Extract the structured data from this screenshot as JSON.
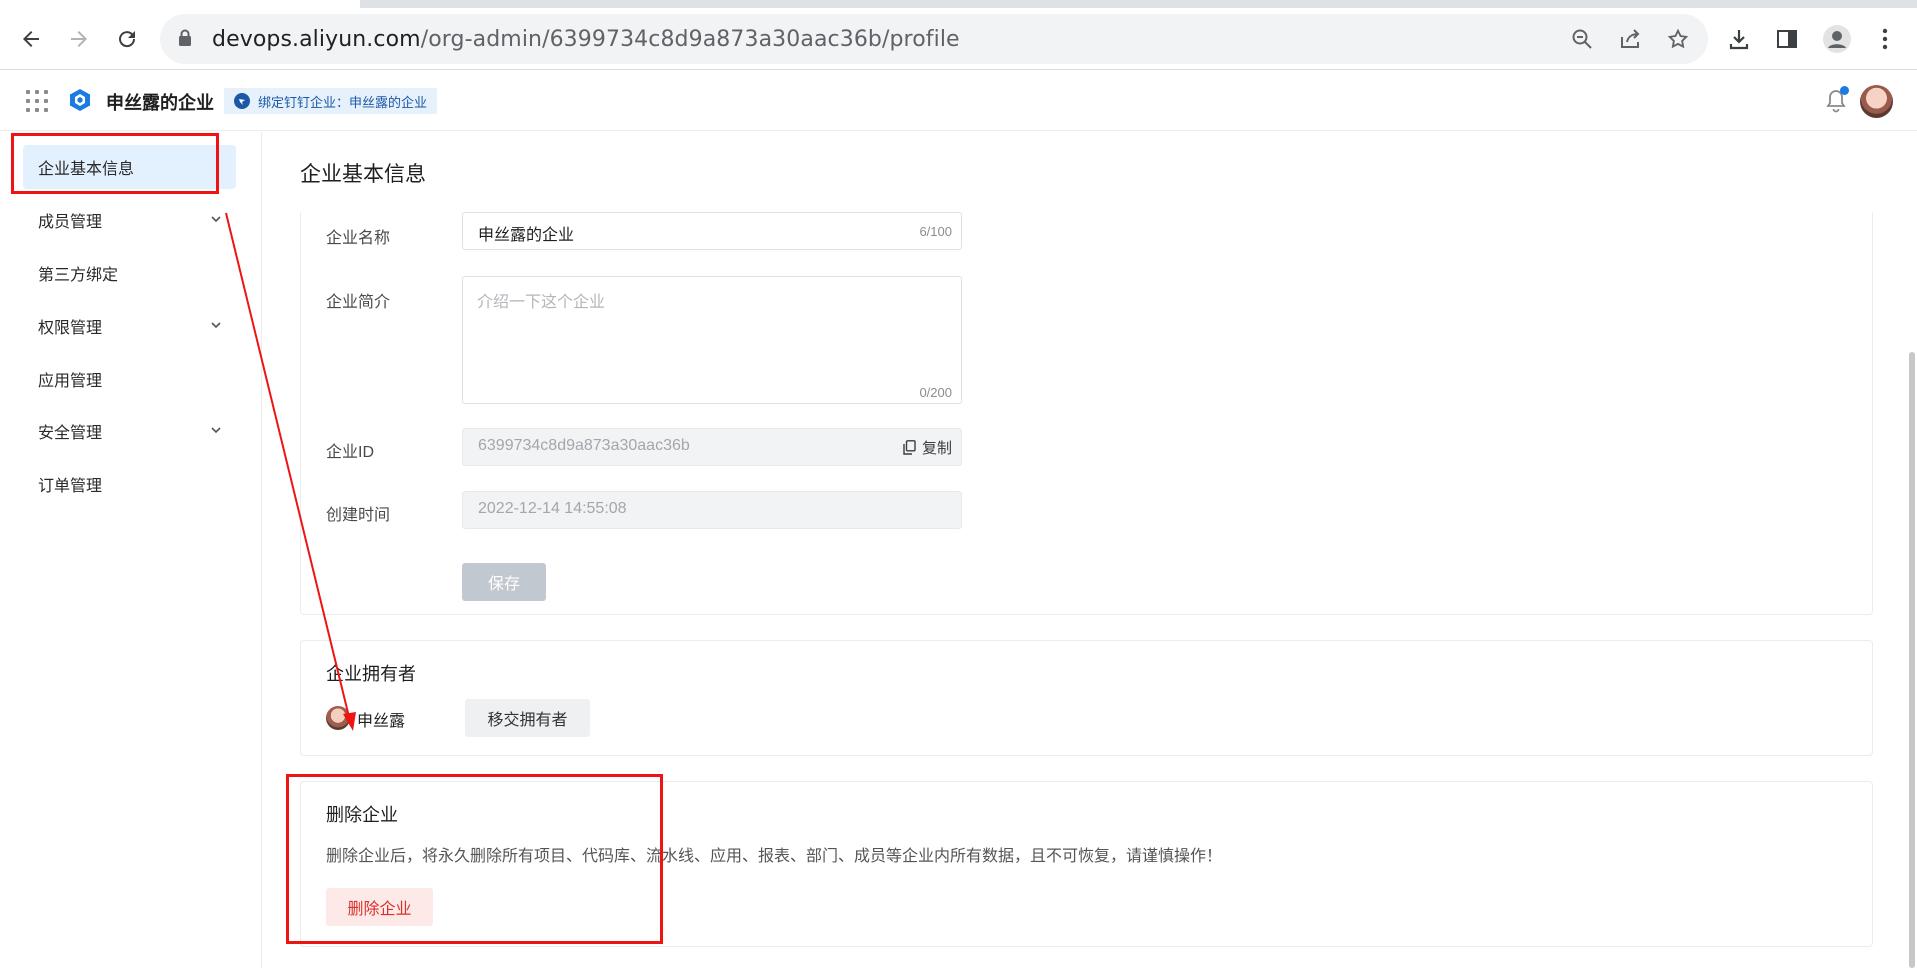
{
  "browser": {
    "url_host": "devops.aliyun.com",
    "url_path": "/org-admin/6399734c8d9a873a30aac36b/profile"
  },
  "header": {
    "org_name": "申丝露的企业",
    "bind_badge": "绑定钉钉企业：申丝露的企业"
  },
  "sidebar": {
    "items": [
      {
        "label": "企业基本信息",
        "active": true,
        "expandable": false
      },
      {
        "label": "成员管理",
        "active": false,
        "expandable": true
      },
      {
        "label": "第三方绑定",
        "active": false,
        "expandable": false
      },
      {
        "label": "权限管理",
        "active": false,
        "expandable": true
      },
      {
        "label": "应用管理",
        "active": false,
        "expandable": false
      },
      {
        "label": "安全管理",
        "active": false,
        "expandable": true
      },
      {
        "label": "订单管理",
        "active": false,
        "expandable": false
      }
    ]
  },
  "main": {
    "page_title": "企业基本信息",
    "form": {
      "name_label": "企业名称",
      "name_value": "申丝露的企业",
      "name_count": "6/100",
      "desc_label": "企业简介",
      "desc_placeholder": "介绍一下这个企业",
      "desc_count": "0/200",
      "id_label": "企业ID",
      "id_value": "6399734c8d9a873a30aac36b",
      "copy_label": "复制",
      "created_label": "创建时间",
      "created_value": "2022-12-14 14:55:08",
      "save_label": "保存"
    },
    "owner": {
      "title": "企业拥有者",
      "name": "申丝露",
      "transfer_label": "移交拥有者"
    },
    "delete": {
      "title": "删除企业",
      "warning": "删除企业后，将永久删除所有项目、代码库、流水线、应用、报表、部门、成员等企业内所有数据，且不可恢复，请谨慎操作！",
      "button_label": "删除企业"
    }
  },
  "colors": {
    "annotation_red": "#ee1414",
    "active_nav_bg": "#e3f0fd",
    "danger": "#d9302c"
  }
}
